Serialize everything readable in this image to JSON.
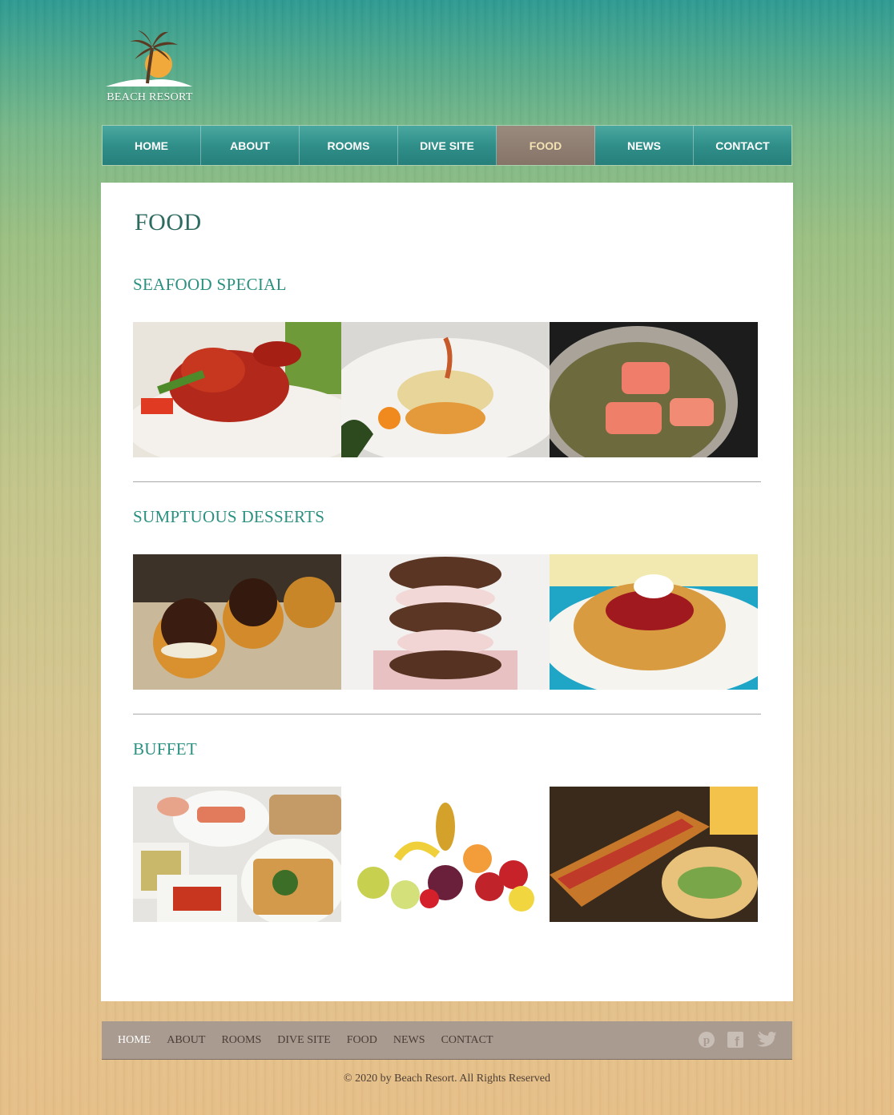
{
  "brand": {
    "name": "BEACH RESORT"
  },
  "nav": {
    "items": [
      {
        "label": "HOME"
      },
      {
        "label": "ABOUT"
      },
      {
        "label": "ROOMS"
      },
      {
        "label": "DIVE SITE"
      },
      {
        "label": "FOOD",
        "active": true
      },
      {
        "label": "NEWS"
      },
      {
        "label": "CONTACT"
      }
    ]
  },
  "page": {
    "title": "FOOD",
    "sections": [
      {
        "title": "SEAFOOD SPECIAL",
        "images": [
          "lobster-dish",
          "fish-fillet-dish",
          "salmon-in-pan"
        ]
      },
      {
        "title": "SUMPTUOUS DESSERTS",
        "images": [
          "profiteroles",
          "ice-cream-cookie-sandwich",
          "berry-waffle"
        ]
      },
      {
        "title": "BUFFET",
        "images": [
          "buffet-platters",
          "fruit-assortment",
          "submarine-sandwich"
        ]
      }
    ]
  },
  "footer": {
    "links": [
      {
        "label": "HOME",
        "active": true
      },
      {
        "label": "ABOUT"
      },
      {
        "label": "ROOMS"
      },
      {
        "label": "DIVE SITE"
      },
      {
        "label": "FOOD"
      },
      {
        "label": "NEWS"
      },
      {
        "label": "CONTACT"
      }
    ],
    "social": [
      "pinterest-icon",
      "facebook-icon",
      "twitter-icon"
    ],
    "copyright": "© 2020 by Beach Resort. All Rights Reserved"
  },
  "colors": {
    "accent_teal": "#2a9080",
    "nav_active": "#857467",
    "footer_bg": "#a99b90"
  }
}
